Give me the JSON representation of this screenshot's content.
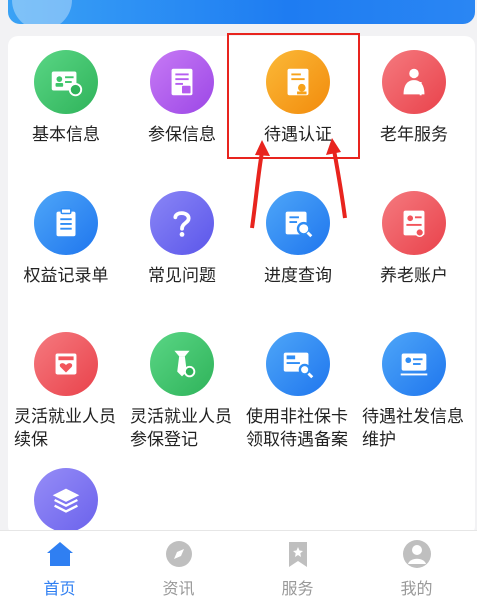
{
  "grid": [
    {
      "label": "基本信息",
      "icon": "id-card-icon",
      "color": "#3ec56a"
    },
    {
      "label": "参保信息",
      "icon": "insurance-doc-icon",
      "color": "#b55df0"
    },
    {
      "label": "待遇认证",
      "icon": "certificate-icon",
      "color": "#f7a21a"
    },
    {
      "label": "老年服务",
      "icon": "elderly-icon",
      "color": "#f2545b"
    },
    {
      "label": "权益记录单",
      "icon": "clipboard-icon",
      "color": "#2f8df5"
    },
    {
      "label": "常见问题",
      "icon": "question-icon",
      "color": "#6a6af2"
    },
    {
      "label": "进度查询",
      "icon": "progress-search-icon",
      "color": "#2f8df5"
    },
    {
      "label": "养老账户",
      "icon": "pension-account-icon",
      "color": "#f2545b"
    },
    {
      "label": "灵活就业人员续保",
      "icon": "renew-heart-icon",
      "color": "#f2545b"
    },
    {
      "label": "灵活就业人员参保登记",
      "icon": "tie-search-icon",
      "color": "#3ec56a"
    },
    {
      "label": "使用非社保卡领取待遇备案",
      "icon": "job-search-icon",
      "color": "#2f8df5"
    },
    {
      "label": "待遇社发信息维护",
      "icon": "info-card-icon",
      "color": "#2f8df5"
    },
    {
      "label": "",
      "icon": "layers-icon",
      "color": "#7a72f2"
    }
  ],
  "tabs": [
    {
      "label": "首页",
      "icon": "home-icon",
      "active": true
    },
    {
      "label": "资讯",
      "icon": "compass-icon",
      "active": false
    },
    {
      "label": "服务",
      "icon": "bookmark-icon",
      "active": false
    },
    {
      "label": "我的",
      "icon": "user-icon",
      "active": false
    }
  ],
  "colors": {
    "accent": "#2f7ff2",
    "highlight": "#e8241e"
  }
}
